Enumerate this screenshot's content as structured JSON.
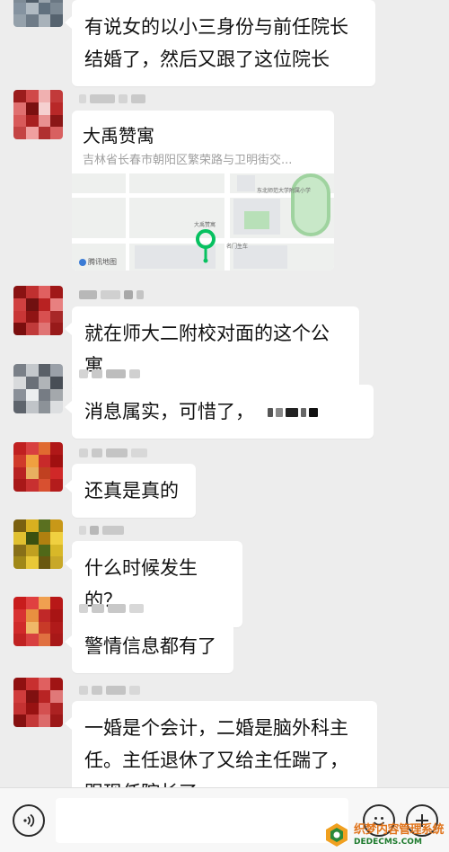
{
  "messages": [
    {
      "text": "有说女的以小三身份与前任院长结婚了，然后又跟了这位院长"
    },
    {
      "type": "location",
      "place_name": "大禹赞寓",
      "address": "吉林省长春市朝阳区繁荣路与卫明街交...",
      "map_labels": {
        "pin": "大禹赞寓",
        "school": "东北师范大学附属小学",
        "bus": "名门生车",
        "credit": "腾讯地图"
      }
    },
    {
      "text": "就在师大二附校对面的这个公寓"
    },
    {
      "text": "消息属实，可惜了，"
    },
    {
      "text": "还真是真的"
    },
    {
      "text": "什么时候发生的？"
    },
    {
      "text": "警情信息都有了"
    },
    {
      "text": "一婚是个会计，二婚是脑外科主任。主任退休了又给主任踹了，跟现任院长了"
    }
  ],
  "input_bar": {
    "voice_icon": "voice-icon",
    "emoji_icon": "emoji-icon",
    "plus_icon": "plus-icon",
    "input_value": ""
  },
  "watermark": {
    "cn": "织梦内容管理系统",
    "en": "DEDECMS.COM"
  },
  "colors": {
    "background": "#ededed",
    "bubble": "#ffffff",
    "pin": "#07c160",
    "watermark_cn": "#e0731a",
    "watermark_en": "#1c7a2c"
  }
}
